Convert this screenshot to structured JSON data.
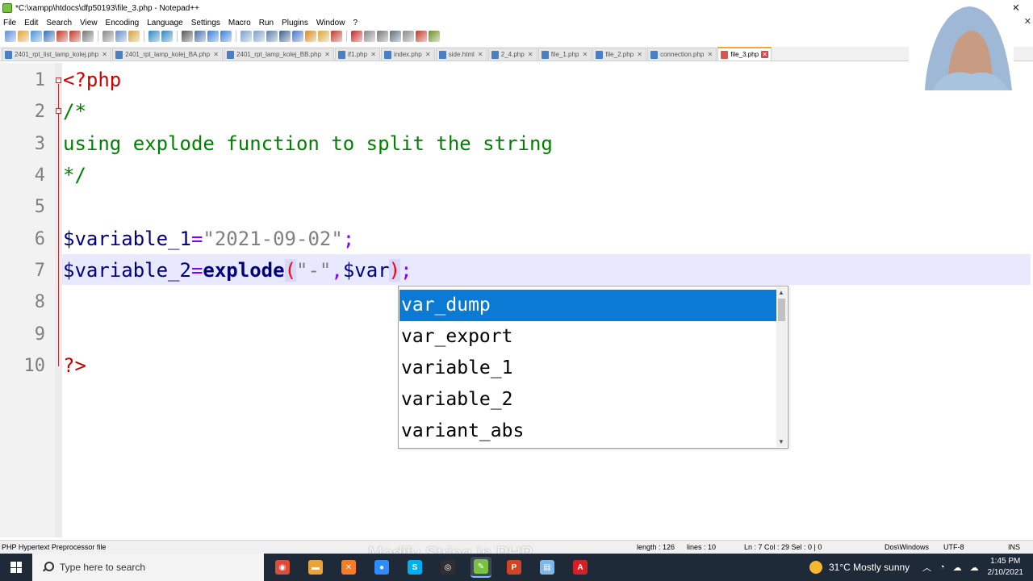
{
  "window": {
    "title": "*C:\\xampp\\htdocs\\dfp50193\\file_3.php - Notepad++"
  },
  "menu": [
    "File",
    "Edit",
    "Search",
    "View",
    "Encoding",
    "Language",
    "Settings",
    "Macro",
    "Run",
    "Plugins",
    "Window",
    "?"
  ],
  "toolbar": {
    "icons": [
      "new-file-icon",
      "open-file-icon",
      "save-icon",
      "save-all-icon",
      "close-icon",
      "close-all-icon",
      "print-icon",
      "cut-icon",
      "copy-icon",
      "paste-icon",
      "undo-icon",
      "redo-icon",
      "find-icon",
      "replace-icon",
      "zoom-in-icon",
      "zoom-out-icon",
      "sync-v-icon",
      "sync-h-icon",
      "wrap-icon",
      "show-all-icon",
      "indent-guide-icon",
      "doc-map-icon",
      "function-list-icon",
      "folder-workspace-icon",
      "record-macro-icon",
      "stop-macro-icon",
      "play-macro-icon",
      "run-macro-icon",
      "save-macro-icon",
      "spell-check-icon",
      "plugin-icon"
    ]
  },
  "tabs": [
    {
      "label": "2401_rpt_list_lamp_kolej.php",
      "active": false
    },
    {
      "label": "2401_rpt_lamp_kolej_BA.php",
      "active": false
    },
    {
      "label": "2401_rpt_lamp_kolej_BB.php",
      "active": false
    },
    {
      "label": "if1.php",
      "active": false
    },
    {
      "label": "index.php",
      "active": false
    },
    {
      "label": "side.html",
      "active": false
    },
    {
      "label": "2_4.php",
      "active": false
    },
    {
      "label": "file_1.php",
      "active": false
    },
    {
      "label": "file_2.php",
      "active": false
    },
    {
      "label": "connection.php",
      "active": false
    },
    {
      "label": "file_3.php",
      "active": true
    }
  ],
  "editor": {
    "line_numbers": [
      "1",
      "2",
      "3",
      "4",
      "5",
      "6",
      "7",
      "8",
      "9",
      "10"
    ],
    "lines": {
      "l1": {
        "open_tag": "<?php"
      },
      "l2": {
        "comment": "/*"
      },
      "l3": {
        "comment": "using explode function to split the string"
      },
      "l4": {
        "comment": "*/"
      },
      "l6": {
        "var": "$variable_1",
        "eq": "=",
        "str": "\"2021-09-02\"",
        "semi": ";"
      },
      "l7": {
        "var": "$variable_2",
        "eq": "=",
        "func": "explode",
        "lparen": "(",
        "str": "\"-\"",
        "comma": ",",
        "arg": "$var",
        "rparen": ")",
        "semi": ";"
      },
      "l10": {
        "close_tag": "?>"
      }
    },
    "current_line": 7
  },
  "autocomplete": {
    "items": [
      "var_dump",
      "var_export",
      "variable_1",
      "variable_2",
      "variant_abs"
    ],
    "selected_index": 0
  },
  "statusbar": {
    "file_type": "PHP Hypertext Preprocessor file",
    "length": "length : 126",
    "lines": "lines : 10",
    "position": "Ln : 7    Col : 29    Sel : 0 | 0",
    "eol": "Dos\\Windows",
    "encoding": "UTF-8",
    "mode": "INS"
  },
  "caption": "Modify String In PHP",
  "taskbar": {
    "search_placeholder": "Type here to search",
    "apps": [
      "chrome-icon",
      "file-explorer-icon",
      "xampp-icon",
      "zoom-icon",
      "skype-icon",
      "obs-icon",
      "notepadpp-icon",
      "powerpoint-icon",
      "notepad-icon",
      "acrobat-icon"
    ],
    "weather": "31°C  Mostly sunny",
    "time": "1:45 PM",
    "date": "2/10/2021"
  },
  "colors": {
    "php_tag": "#cc0000",
    "comment": "#008000",
    "variable": "#000080",
    "operator": "#8000ff",
    "string": "#808080",
    "current_line_bg": "#e8e8ff",
    "autocomplete_selected": "#0a7ad4",
    "taskbar_bg": "#1f2a38"
  }
}
